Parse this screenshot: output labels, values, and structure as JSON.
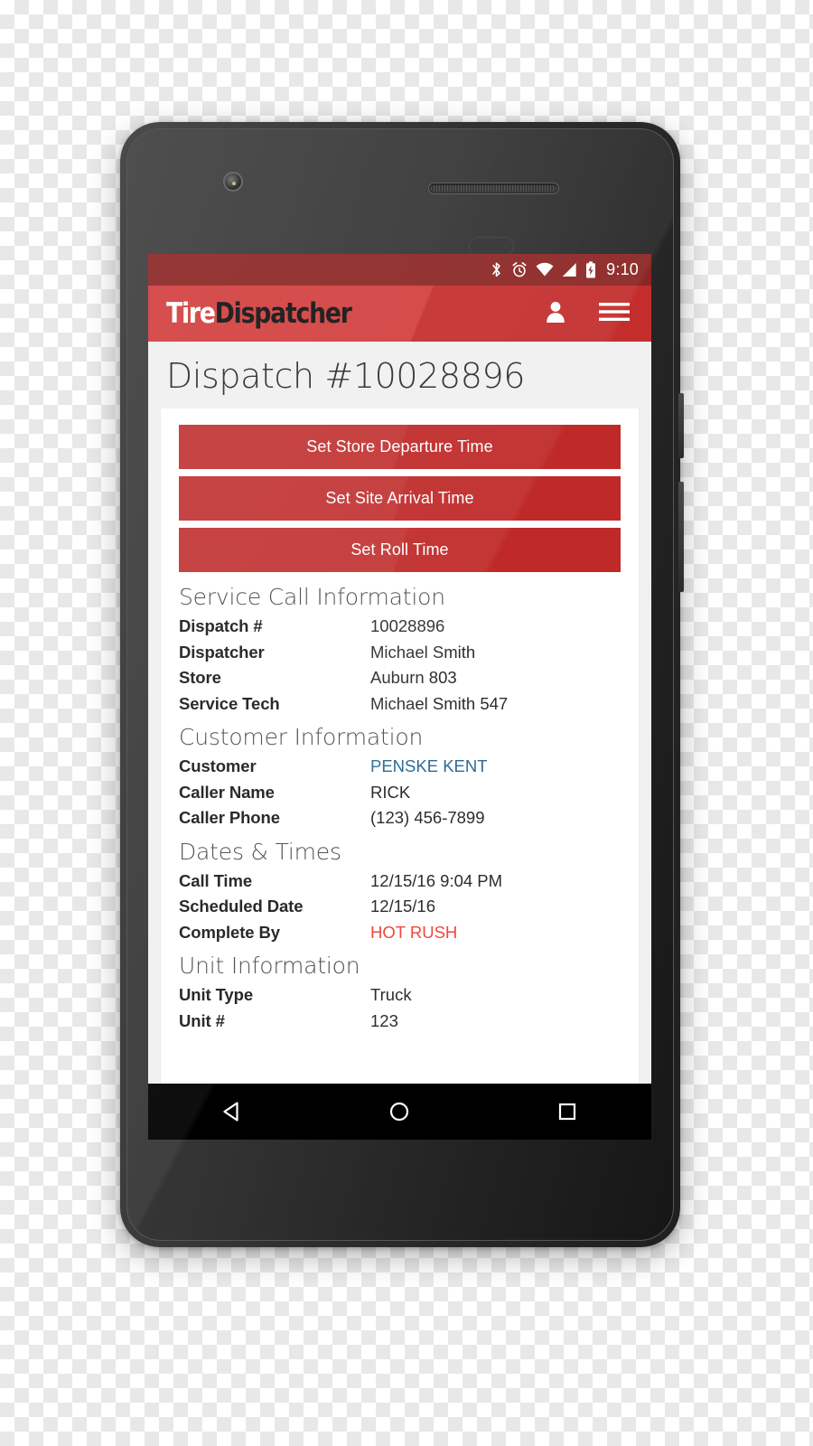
{
  "statusbar": {
    "icons": [
      "bluetooth-icon",
      "alarm-icon",
      "wifi-icon",
      "cell-signal-icon",
      "battery-charging-icon"
    ],
    "time": "9:10"
  },
  "appbar": {
    "logo_first": "Tire",
    "logo_second": "Dispatcher",
    "account_icon": "person-icon",
    "menu_icon": "hamburger-menu-icon"
  },
  "page": {
    "title": "Dispatch #10028896",
    "actions": [
      {
        "label": "Set Store Departure Time"
      },
      {
        "label": "Set Site Arrival Time"
      },
      {
        "label": "Set Roll Time"
      }
    ],
    "sections": [
      {
        "heading": "Service Call Information",
        "rows": [
          {
            "label": "Dispatch #",
            "value": "10028896",
            "style": "plain"
          },
          {
            "label": "Dispatcher",
            "value": "Michael Smith",
            "style": "plain"
          },
          {
            "label": "Store",
            "value": "Auburn 803",
            "style": "plain"
          },
          {
            "label": "Service Tech",
            "value": "Michael Smith 547",
            "style": "plain"
          }
        ]
      },
      {
        "heading": "Customer Information",
        "rows": [
          {
            "label": "Customer",
            "value": "PENSKE KENT",
            "style": "link"
          },
          {
            "label": "Caller Name",
            "value": "RICK",
            "style": "plain"
          },
          {
            "label": "Caller Phone",
            "value": "(123) 456-7899",
            "style": "plain"
          }
        ]
      },
      {
        "heading": "Dates & Times",
        "rows": [
          {
            "label": "Call Time",
            "value": "12/15/16 9:04 PM",
            "style": "plain"
          },
          {
            "label": "Scheduled Date",
            "value": "12/15/16",
            "style": "plain"
          },
          {
            "label": "Complete By",
            "value": "HOT RUSH",
            "style": "alert"
          }
        ]
      },
      {
        "heading": "Unit Information",
        "rows": [
          {
            "label": "Unit Type",
            "value": "Truck",
            "style": "plain"
          },
          {
            "label": "Unit #",
            "value": "123",
            "style": "plain"
          }
        ]
      }
    ]
  },
  "navbar": {
    "back_icon": "back-triangle-icon",
    "home_icon": "home-circle-icon",
    "recents_icon": "recents-square-icon"
  },
  "colors": {
    "statusbar": "#8b2624",
    "appbar": "#cf3130",
    "button": "#bf2a29",
    "link": "#2c6b96",
    "alert": "#f0473c",
    "page_bg": "#f0f0f0",
    "card_bg": "#ffffff"
  }
}
